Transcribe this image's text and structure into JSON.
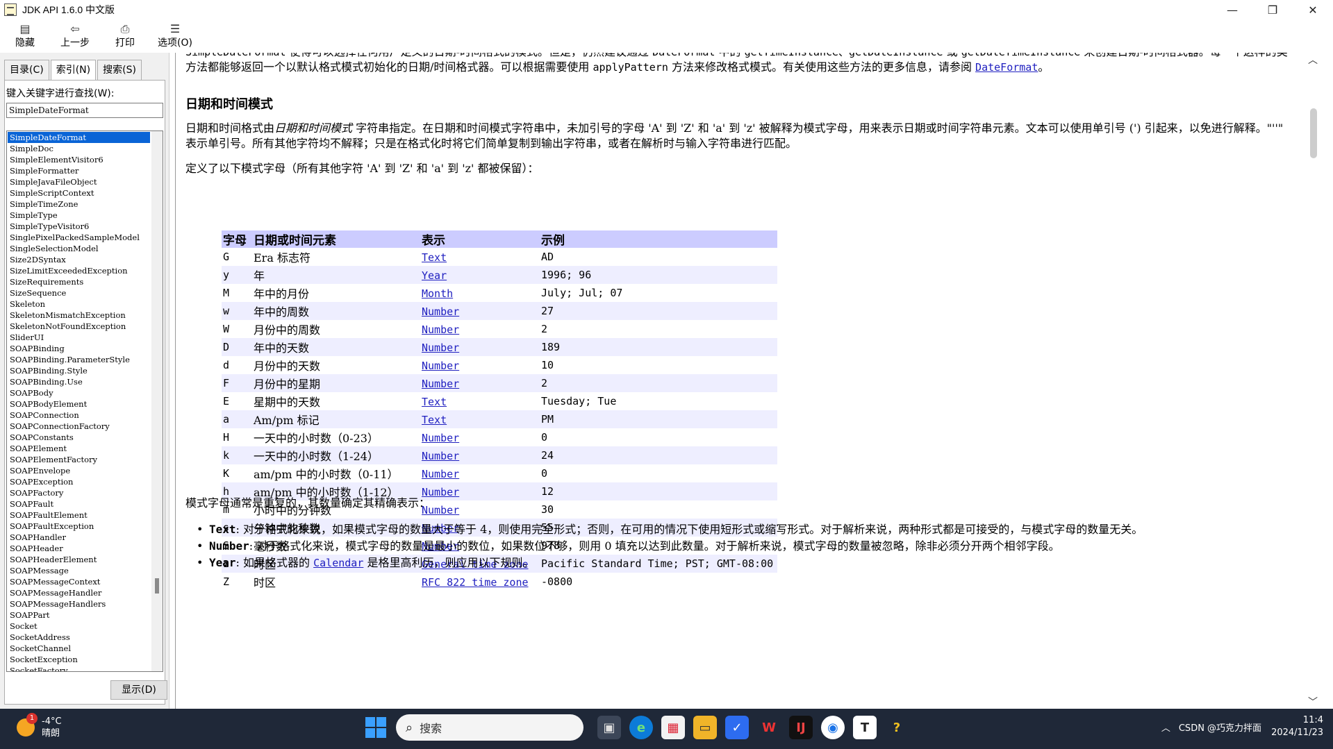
{
  "window": {
    "title": "JDK API 1.6.0 中文版",
    "minimize": "—",
    "restore": "❐",
    "close": "✕"
  },
  "toolbar": [
    {
      "name": "hide-button",
      "icon": "▤",
      "label": "隐藏"
    },
    {
      "name": "back-button",
      "icon": "⇦",
      "label": "上一步"
    },
    {
      "name": "print-button",
      "icon": "⎙",
      "label": "打印"
    },
    {
      "name": "options-button",
      "icon": "☰",
      "label": "选项(O)"
    }
  ],
  "tabs": [
    "目录(C)",
    "索引(N)",
    "搜索(S)"
  ],
  "index": {
    "keyword_label": "键入关键字进行查找(W):",
    "keyword_value": "SimpleDateFormat",
    "items": [
      "SimpleDateFormat",
      "SimpleDoc",
      "SimpleElementVisitor6",
      "SimpleFormatter",
      "SimpleJavaFileObject",
      "SimpleScriptContext",
      "SimpleTimeZone",
      "SimpleType",
      "SimpleTypeVisitor6",
      "SinglePixelPackedSampleModel",
      "SingleSelectionModel",
      "Size2DSyntax",
      "SizeLimitExceededException",
      "SizeRequirements",
      "SizeSequence",
      "Skeleton",
      "SkeletonMismatchException",
      "SkeletonNotFoundException",
      "SliderUI",
      "SOAPBinding",
      "SOAPBinding.ParameterStyle",
      "SOAPBinding.Style",
      "SOAPBinding.Use",
      "SOAPBody",
      "SOAPBodyElement",
      "SOAPConnection",
      "SOAPConnectionFactory",
      "SOAPConstants",
      "SOAPElement",
      "SOAPElementFactory",
      "SOAPEnvelope",
      "SOAPException",
      "SOAPFactory",
      "SOAPFault",
      "SOAPFaultElement",
      "SOAPFaultException",
      "SOAPHandler",
      "SOAPHeader",
      "SOAPHeaderElement",
      "SOAPMessage",
      "SOAPMessageContext",
      "SOAPMessageHandler",
      "SOAPMessageHandlers",
      "SOAPPart",
      "Socket",
      "SocketAddress",
      "SocketChannel",
      "SocketException",
      "SocketFactory"
    ],
    "show_button": "显示(D)"
  },
  "doc": {
    "intro_1": "SimpleDateFormat",
    "intro_2": " 使得可以选择任何用户定义的日期-时间格式的模式。但是，仍然建议通过 ",
    "intro_3": "DateFormat",
    "intro_4": " 中的 ",
    "intro_5": "getTimeInstance、getDateInstance",
    "intro_6": " 或 ",
    "intro_7": "getDateTimeInstance",
    "intro_8": " 来创建日期-时间格式器。每一个这样的类方法都能够返回一个以默认格式模式初始化的日期/时间格式器。可以根据需要使用 ",
    "intro_9": "applyPattern",
    "intro_10": " 方法来修改格式模式。有关使用这些方法的更多信息，请参阅 ",
    "intro_link": "DateFormat",
    "intro_end": "。",
    "heading": "日期和时间模式",
    "p1_a": "日期和时间格式由",
    "p1_b": "日期和时间模式",
    "p1_c": " 字符串指定。在日期和时间模式字符串中，未加引号的字母 'A' 到 'Z' 和 'a' 到 'z' 被解释为模式字母，用来表示日期或时间字符串元素。文本可以使用单引号 (') 引起来，以免进行解释。\"''\" 表示单引号。所有其他字符均不解释；只是在格式化时将它们简单复制到输出字符串，或者在解析时与输入字符串进行匹配。",
    "p2": "定义了以下模式字母（所有其他字符 'A' 到 'Z' 和 'a' 到 'z' 都被保留）：",
    "table_headers": [
      "字母",
      "日期或时间元素",
      "表示",
      "示例"
    ],
    "table_rows": [
      [
        "G",
        "Era 标志符",
        "Text",
        "AD"
      ],
      [
        "y",
        "年",
        "Year",
        "1996; 96"
      ],
      [
        "M",
        "年中的月份",
        "Month",
        "July; Jul; 07"
      ],
      [
        "w",
        "年中的周数",
        "Number",
        "27"
      ],
      [
        "W",
        "月份中的周数",
        "Number",
        "2"
      ],
      [
        "D",
        "年中的天数",
        "Number",
        "189"
      ],
      [
        "d",
        "月份中的天数",
        "Number",
        "10"
      ],
      [
        "F",
        "月份中的星期",
        "Number",
        "2"
      ],
      [
        "E",
        "星期中的天数",
        "Text",
        "Tuesday; Tue"
      ],
      [
        "a",
        "Am/pm 标记",
        "Text",
        "PM"
      ],
      [
        "H",
        "一天中的小时数（0-23）",
        "Number",
        "0"
      ],
      [
        "k",
        "一天中的小时数（1-24）",
        "Number",
        "24"
      ],
      [
        "K",
        "am/pm 中的小时数（0-11）",
        "Number",
        "0"
      ],
      [
        "h",
        "am/pm 中的小时数（1-12）",
        "Number",
        "12"
      ],
      [
        "m",
        "小时中的分钟数",
        "Number",
        "30"
      ],
      [
        "s",
        "分钟中的秒数",
        "Number",
        "55"
      ],
      [
        "S",
        "毫秒数",
        "Number",
        "978"
      ],
      [
        "z",
        "时区",
        "General time zone",
        "Pacific Standard Time; PST; GMT-08:00"
      ],
      [
        "Z",
        "时区",
        "RFC 822 time zone",
        "-0800"
      ]
    ],
    "p3": "模式字母通常是重复的，其数量确定其精确表示：",
    "bullets": [
      {
        "term": "Text",
        "text": ": 对于格式化来说，如果模式字母的数量大于等于 4，则使用完全形式；否则，在可用的情况下使用短形式或缩写形式。对于解析来说，两种形式都是可接受的，与模式字母的数量无关。"
      },
      {
        "term": "Number",
        "text": ": 对于格式化来说，模式字母的数量是最小的数位，如果数位不够，则用 0 填充以达到此数量。对于解析来说，模式字母的数量被忽略，除非必须分开两个相邻字段。"
      },
      {
        "term": "Year",
        "text_a": ": 如果格式器的 ",
        "link": "Calendar",
        "text_b": " 是格里高利历，则应用以下规则。"
      }
    ]
  },
  "taskbar": {
    "weather_temp": "-4°C",
    "weather_desc": "晴朗",
    "weather_badge": "1",
    "search_placeholder": "搜索",
    "time": "11:4",
    "date": "2024/11/23",
    "watermark": "CSDN @巧克力拌面"
  }
}
